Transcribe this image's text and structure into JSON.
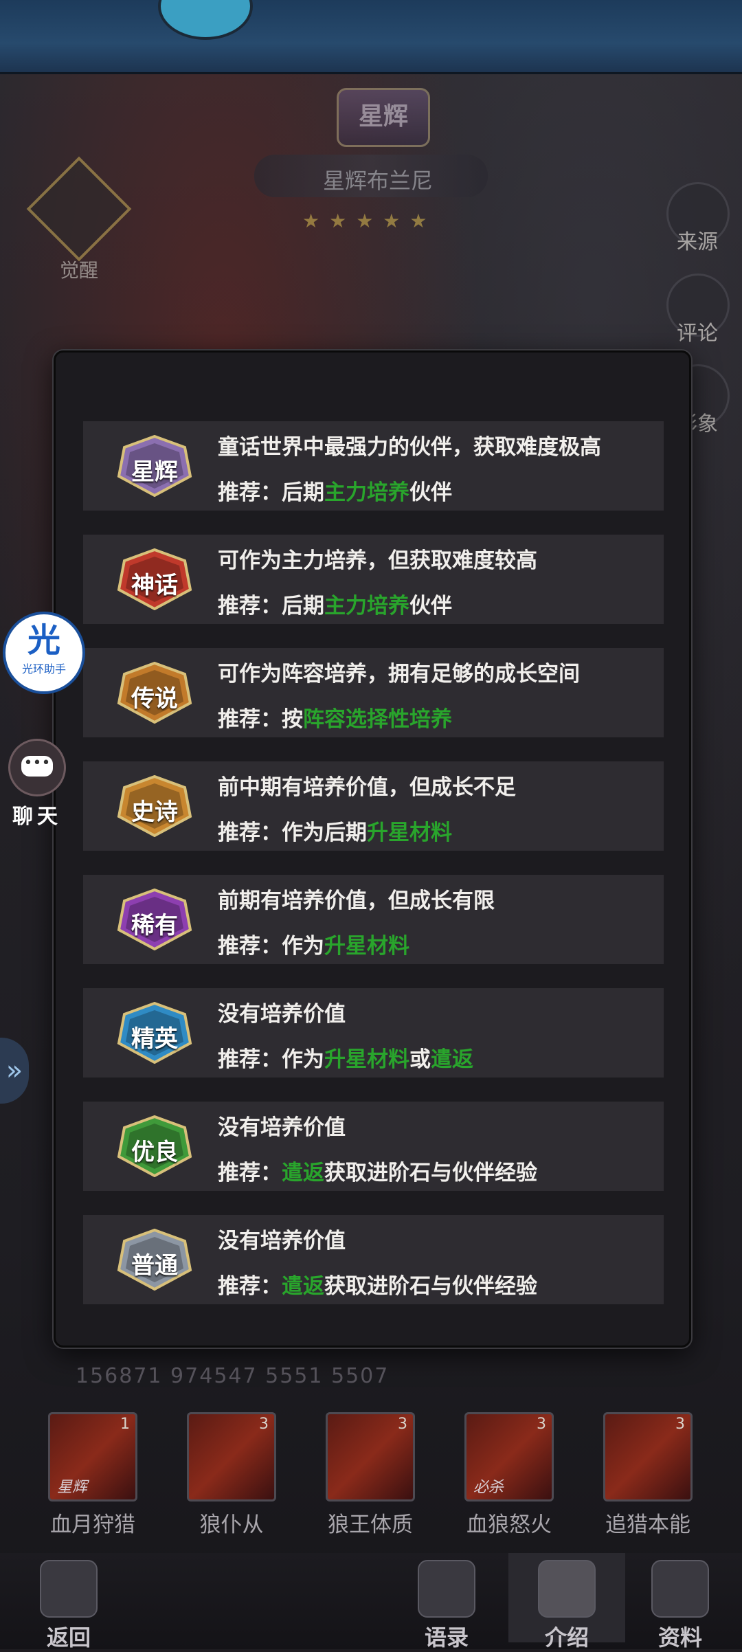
{
  "background": {
    "title_crest": "星辉",
    "hero_name": "星辉布兰尼",
    "stars_text": "★★★★★",
    "left_button": "觉醒",
    "right_buttons": [
      "来源",
      "评论",
      "形象"
    ]
  },
  "floating": {
    "helper_big": "光",
    "helper_small": "光环助手",
    "chat_label": "聊天"
  },
  "modal": {
    "rows": [
      {
        "badge": "星辉",
        "badge_color": "#8b6fb0",
        "line1": "童话世界中最强力的伙伴，获取难度极高",
        "prefix": "推荐：后期",
        "hl1": "主力培养",
        "mid": "伙伴",
        "hl2": "",
        "suffix": ""
      },
      {
        "badge": "神话",
        "badge_color": "#c0392b",
        "line1": "可作为主力培养，但获取难度较高",
        "prefix": "推荐：后期",
        "hl1": "主力培养",
        "mid": "伙伴",
        "hl2": "",
        "suffix": ""
      },
      {
        "badge": "传说",
        "badge_color": "#c27a2a",
        "line1": "可作为阵容培养，拥有足够的成长空间",
        "prefix": "推荐：按",
        "hl1": "阵容选择性培养",
        "mid": "",
        "hl2": "",
        "suffix": ""
      },
      {
        "badge": "史诗",
        "badge_color": "#c8862f",
        "line1": "前中期有培养价值，但成长不足",
        "prefix": "推荐：作为后期",
        "hl1": "升星材料",
        "mid": "",
        "hl2": "",
        "suffix": ""
      },
      {
        "badge": "稀有",
        "badge_color": "#8d3fb0",
        "line1": "前期有培养价值，但成长有限",
        "prefix": "推荐：作为",
        "hl1": "升星材料",
        "mid": "",
        "hl2": "",
        "suffix": ""
      },
      {
        "badge": "精英",
        "badge_color": "#2f8bc4",
        "line1": "没有培养价值",
        "prefix": "推荐：作为",
        "hl1": "升星材料",
        "mid": "或",
        "hl2": "遣返",
        "suffix": ""
      },
      {
        "badge": "优良",
        "badge_color": "#3f9a3a",
        "line1": "没有培养价值",
        "prefix": "推荐：",
        "hl1": "遣返",
        "mid": "获取进阶石与伙伴经验",
        "hl2": "",
        "suffix": ""
      },
      {
        "badge": "普通",
        "badge_color": "#8c96a3",
        "line1": "没有培养价值",
        "prefix": "推荐：",
        "hl1": "遣返",
        "mid": "获取进阶石与伙伴经验",
        "hl2": "",
        "suffix": ""
      }
    ]
  },
  "stats": {
    "text": "156871    974547    5551    5507"
  },
  "skills": [
    {
      "name": "血月狩猎",
      "level": "1",
      "tag": "星辉"
    },
    {
      "name": "狼仆从",
      "level": "3",
      "tag": ""
    },
    {
      "name": "狼王体质",
      "level": "3",
      "tag": ""
    },
    {
      "name": "血狼怒火",
      "level": "3",
      "tag": "必杀"
    },
    {
      "name": "追猎本能",
      "level": "3",
      "tag": ""
    }
  ],
  "nav": {
    "back": "返回",
    "voice": "语录",
    "intro": "介绍",
    "info": "资料"
  }
}
